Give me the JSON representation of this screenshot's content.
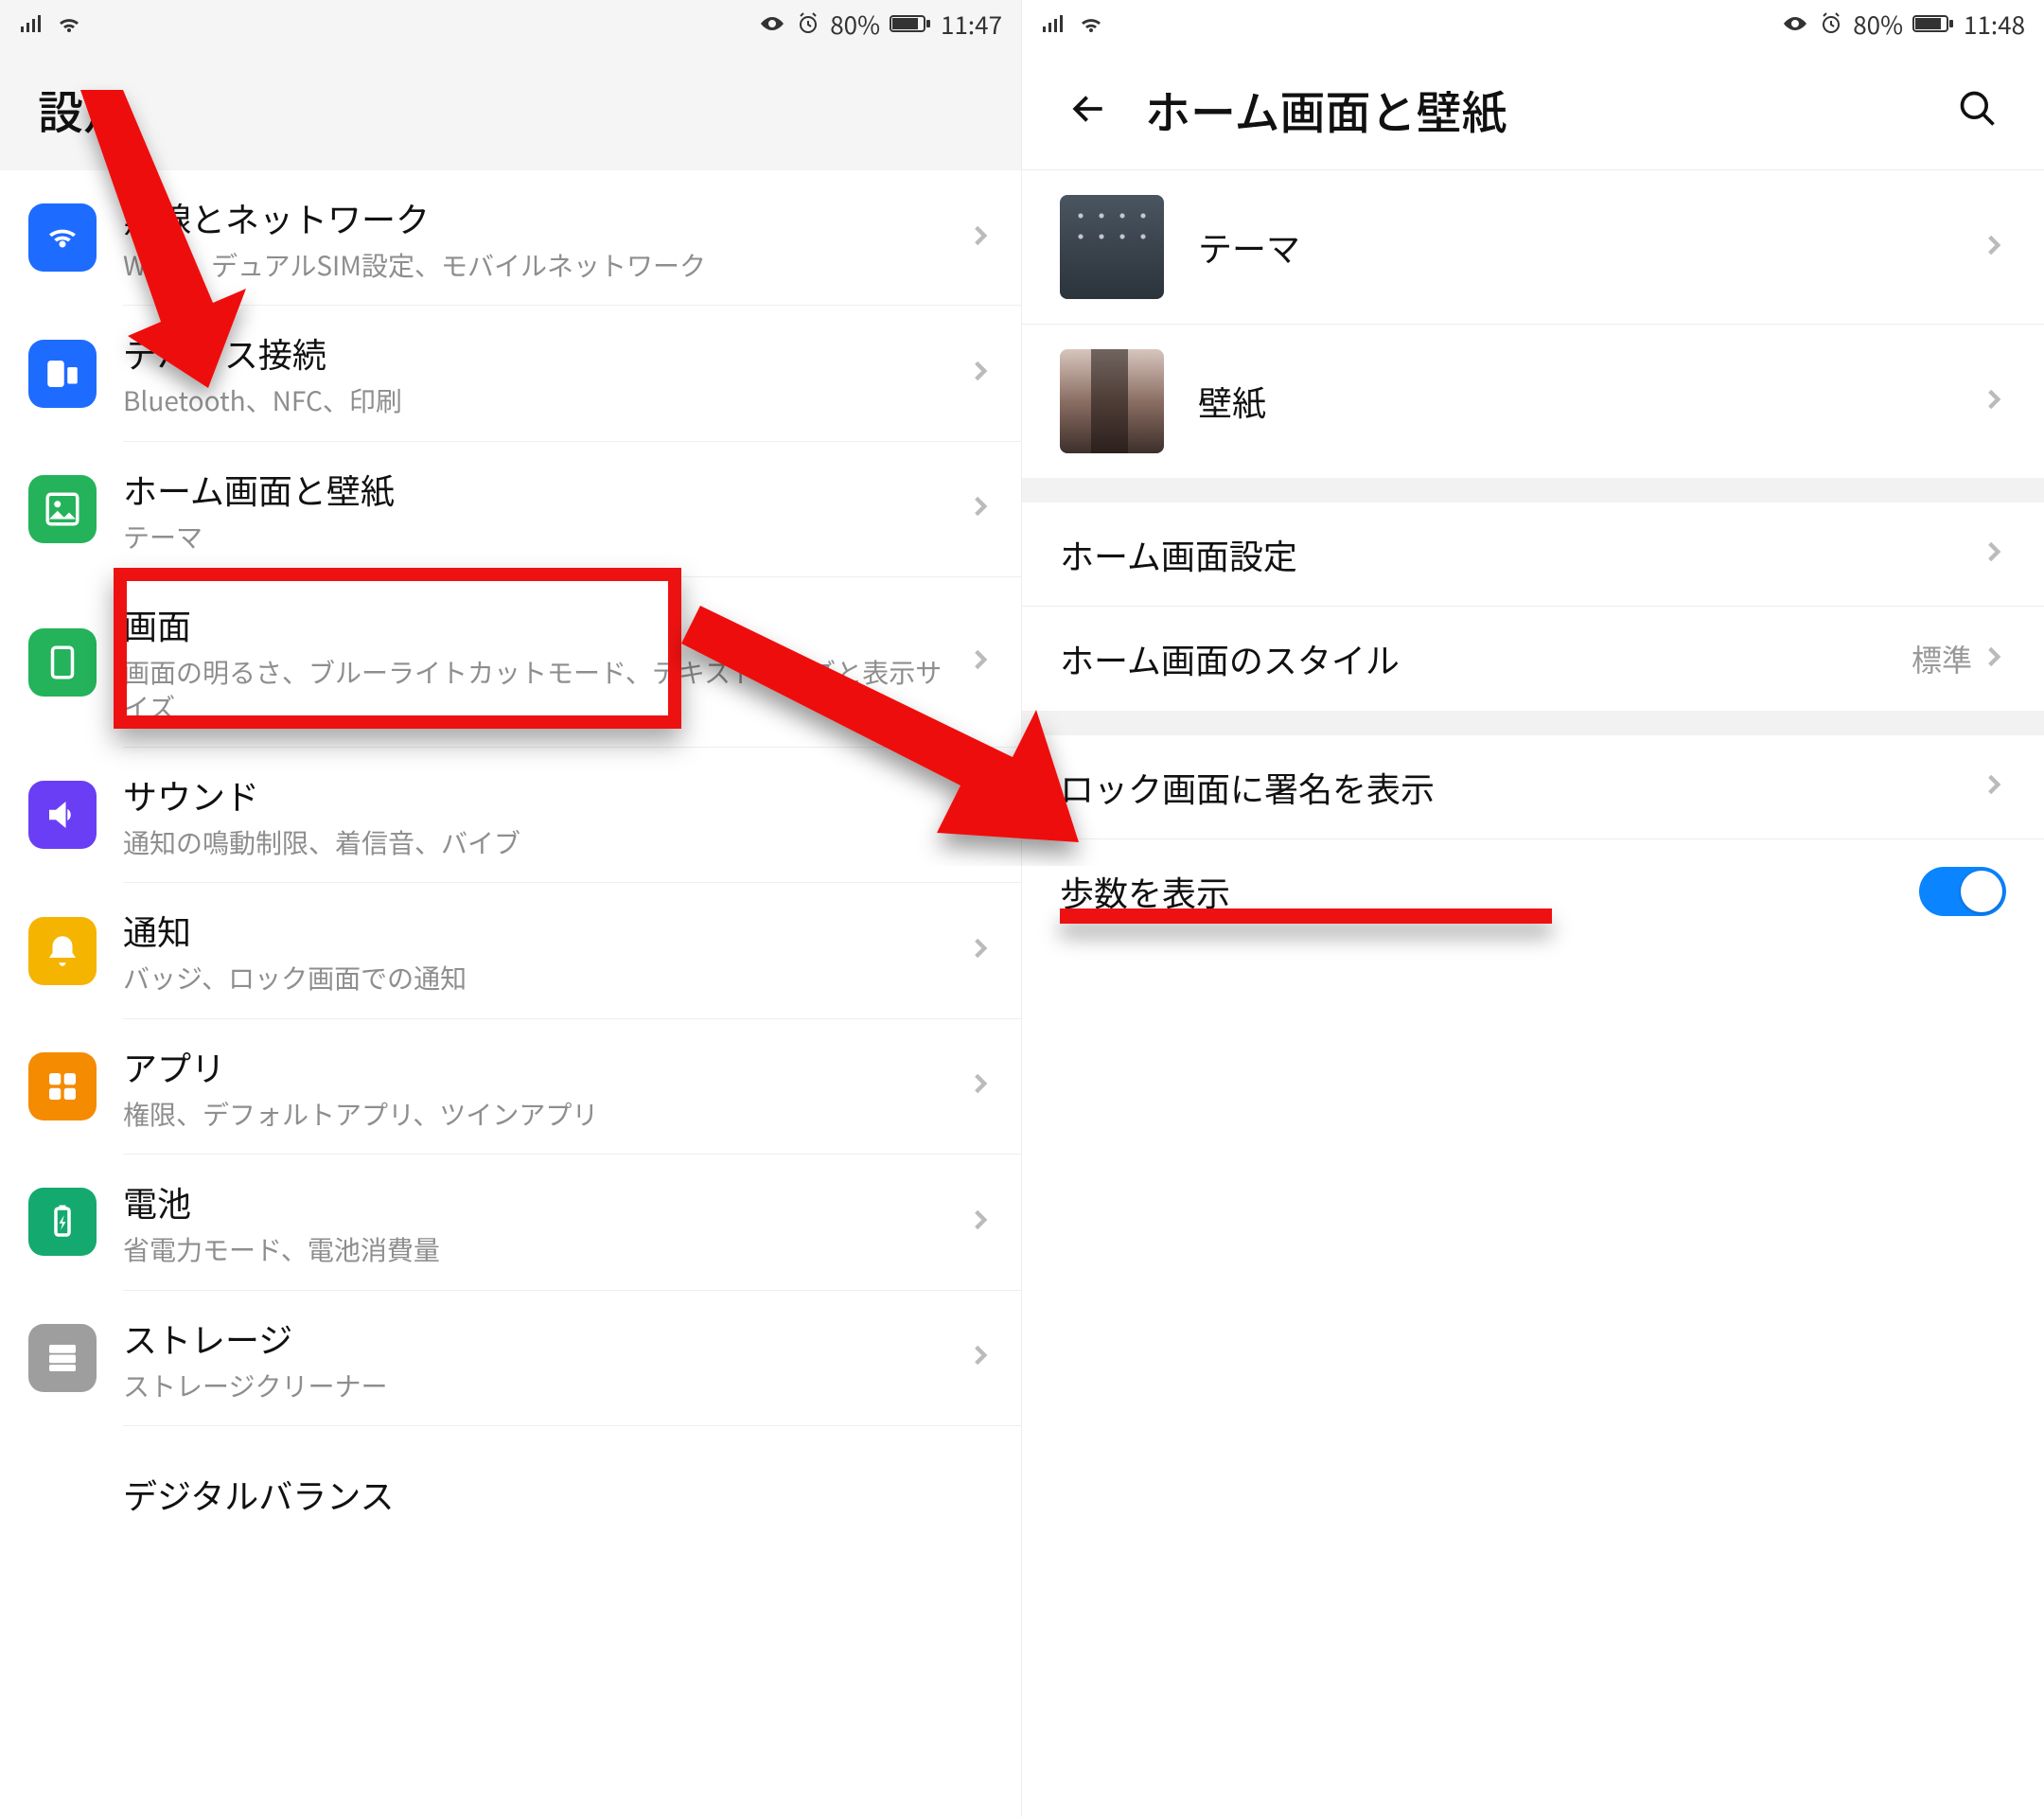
{
  "left": {
    "status": {
      "battery": "80%",
      "time": "11:47"
    },
    "header_title": "設定",
    "items": [
      {
        "title": "無線とネットワーク",
        "sub": "Wi-Fi、デュアルSIM設定、モバイルネットワーク"
      },
      {
        "title": "デバイス接続",
        "sub": "Bluetooth、NFC、印刷"
      },
      {
        "title": "ホーム画面と壁紙",
        "sub": "テーマ"
      },
      {
        "title": "画面",
        "sub": "画面の明るさ、ブルーライトカットモード、テキストサイズと表示サイズ"
      },
      {
        "title": "サウンド",
        "sub": "通知の鳴動制限、着信音、バイブ"
      },
      {
        "title": "通知",
        "sub": "バッジ、ロック画面での通知"
      },
      {
        "title": "アプリ",
        "sub": "権限、デフォルトアプリ、ツインアプリ"
      },
      {
        "title": "電池",
        "sub": "省電力モード、電池消費量"
      },
      {
        "title": "ストレージ",
        "sub": "ストレージクリーナー"
      },
      {
        "title": "デジタルバランス",
        "sub": ""
      }
    ]
  },
  "right": {
    "status": {
      "battery": "80%",
      "time": "11:48"
    },
    "header_title": "ホーム画面と壁紙",
    "theme_label": "テーマ",
    "wallpaper_label": "壁紙",
    "home_settings_label": "ホーム画面設定",
    "home_style_label": "ホーム画面のスタイル",
    "home_style_value": "標準",
    "lock_sign_label": "ロック画面に署名を表示",
    "steps_label": "歩数を表示"
  }
}
